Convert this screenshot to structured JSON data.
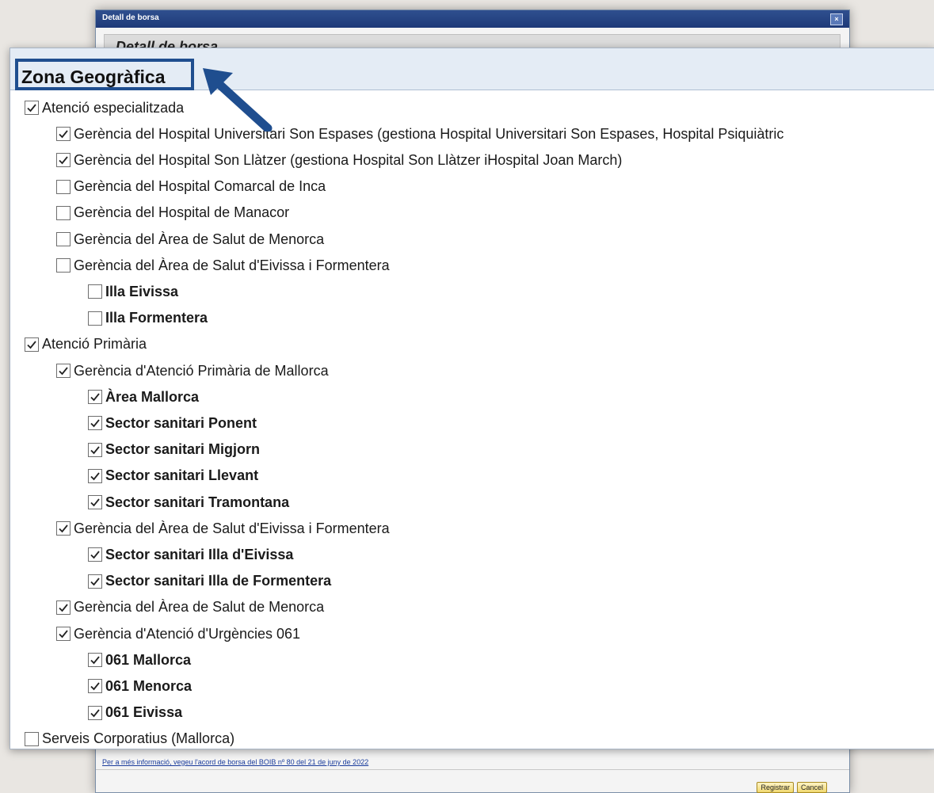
{
  "window": {
    "title": "Detall de borsa",
    "close": "×",
    "header": "Detall de borsa",
    "footer_link": "Per a més informació, vegeu l'acord de borsa del BOIB nº 80 del 21 de juny de 2022",
    "buttons": {
      "register": "Registrar",
      "cancel": "Cancel"
    }
  },
  "panel": {
    "title": "Zona Geogràfica",
    "accent_color": "#1f4e8f"
  },
  "tree": [
    {
      "level": 0,
      "label": "Atenció especialitzada",
      "checked": true,
      "bold": false
    },
    {
      "level": 1,
      "label": "Gerència del Hospital Universitari Son Espases (gestiona Hospital Universitari Son Espases, Hospital Psiquiàtric",
      "checked": true,
      "bold": false
    },
    {
      "level": 1,
      "label": "Gerència del Hospital Son Llàtzer (gestiona Hospital Son Llàtzer iHospital Joan March)",
      "checked": true,
      "bold": false
    },
    {
      "level": 1,
      "label": "Gerència del Hospital Comarcal de Inca",
      "checked": false,
      "bold": false
    },
    {
      "level": 1,
      "label": "Gerència del Hospital de Manacor",
      "checked": false,
      "bold": false
    },
    {
      "level": 1,
      "label": "Gerència del Àrea de Salut de Menorca",
      "checked": false,
      "bold": false
    },
    {
      "level": 1,
      "label": "Gerència del Àrea de Salut d'Eivissa i Formentera",
      "checked": false,
      "bold": false
    },
    {
      "level": 2,
      "label": "Illa Eivissa",
      "checked": false,
      "bold": true
    },
    {
      "level": 2,
      "label": "Illa Formentera",
      "checked": false,
      "bold": true
    },
    {
      "level": 0,
      "label": "Atenció Primària",
      "checked": true,
      "bold": false
    },
    {
      "level": 1,
      "label": "Gerència d'Atenció Primària de Mallorca",
      "checked": true,
      "bold": false
    },
    {
      "level": 2,
      "label": "Àrea Mallorca",
      "checked": true,
      "bold": true
    },
    {
      "level": 2,
      "label": "Sector sanitari Ponent",
      "checked": true,
      "bold": true
    },
    {
      "level": 2,
      "label": "Sector sanitari Migjorn",
      "checked": true,
      "bold": true
    },
    {
      "level": 2,
      "label": "Sector sanitari Llevant",
      "checked": true,
      "bold": true
    },
    {
      "level": 2,
      "label": "Sector sanitari Tramontana",
      "checked": true,
      "bold": true
    },
    {
      "level": 1,
      "label": "Gerència del Àrea de Salut d'Eivissa i Formentera",
      "checked": true,
      "bold": false
    },
    {
      "level": 2,
      "label": "Sector sanitari Illa d'Eivissa",
      "checked": true,
      "bold": true
    },
    {
      "level": 2,
      "label": "Sector sanitari Illa de Formentera",
      "checked": true,
      "bold": true
    },
    {
      "level": 1,
      "label": "Gerència del Àrea de Salut de Menorca",
      "checked": true,
      "bold": false
    },
    {
      "level": 1,
      "label": "Gerència d'Atenció d'Urgències 061",
      "checked": true,
      "bold": false
    },
    {
      "level": 2,
      "label": "061 Mallorca",
      "checked": true,
      "bold": true
    },
    {
      "level": 2,
      "label": "061 Menorca",
      "checked": true,
      "bold": true
    },
    {
      "level": 2,
      "label": "061 Eivissa",
      "checked": true,
      "bold": true
    },
    {
      "level": 0,
      "label": "Serveis Corporatius (Mallorca)",
      "checked": false,
      "bold": false
    }
  ]
}
